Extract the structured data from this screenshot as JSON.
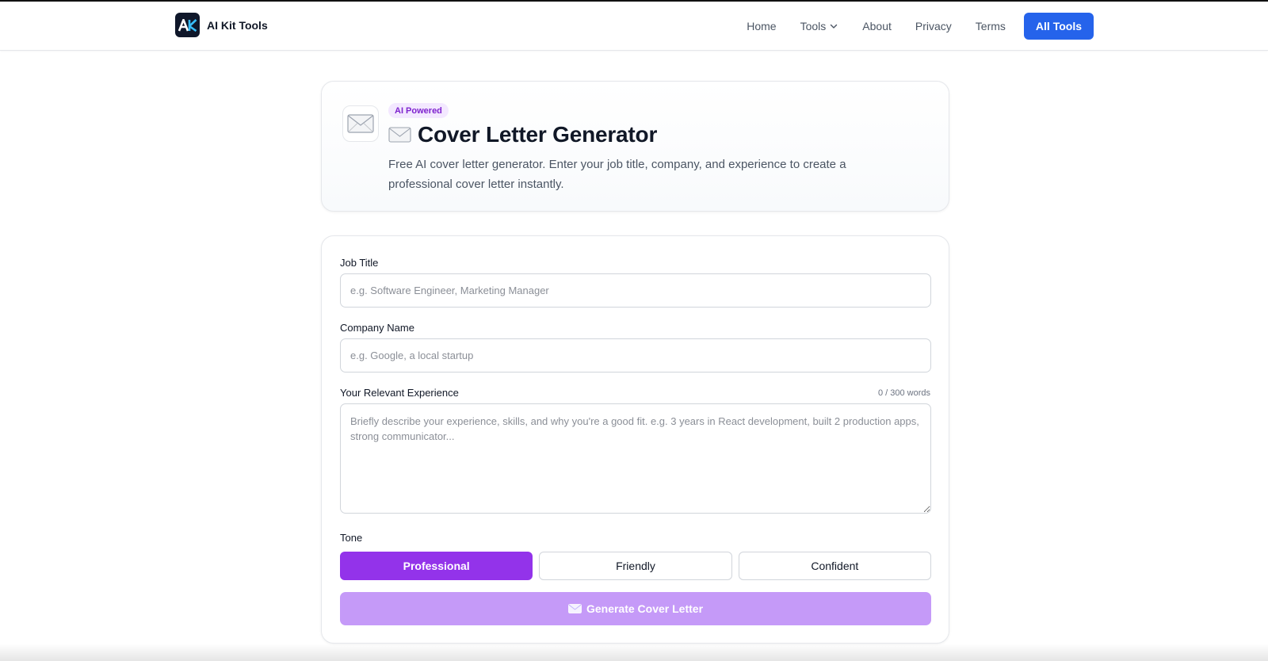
{
  "brand": {
    "name": "AI Kit Tools",
    "logo_text": "AK"
  },
  "nav": {
    "home": "Home",
    "tools": "Tools",
    "about": "About",
    "privacy": "Privacy",
    "terms": "Terms",
    "cta": "All Tools"
  },
  "hero": {
    "badge": "AI Powered",
    "title": "Cover Letter Generator",
    "description": "Free AI cover letter generator. Enter your job title, company, and experience to create a professional cover letter instantly.",
    "icon": "envelope-icon"
  },
  "form": {
    "job_title": {
      "label": "Job Title",
      "value": "",
      "placeholder": "e.g. Software Engineer, Marketing Manager"
    },
    "company": {
      "label": "Company Name",
      "value": "",
      "placeholder": "e.g. Google, a local startup"
    },
    "experience": {
      "label": "Your Relevant Experience",
      "counter": "0 / 300 words",
      "value": "",
      "placeholder": "Briefly describe your experience, skills, and why you're a good fit. e.g. 3 years in React development, built 2 production apps, strong communicator..."
    },
    "tone": {
      "label": "Tone",
      "options": [
        "Professional",
        "Friendly",
        "Confident"
      ],
      "selected": "Professional"
    },
    "generate_label": "Generate Cover Letter"
  },
  "colors": {
    "accent_blue": "#2563eb",
    "accent_purple": "#9333ea",
    "generate_disabled": "#c59af8",
    "badge_bg": "#f3e8ff",
    "badge_text": "#7e22ce"
  }
}
